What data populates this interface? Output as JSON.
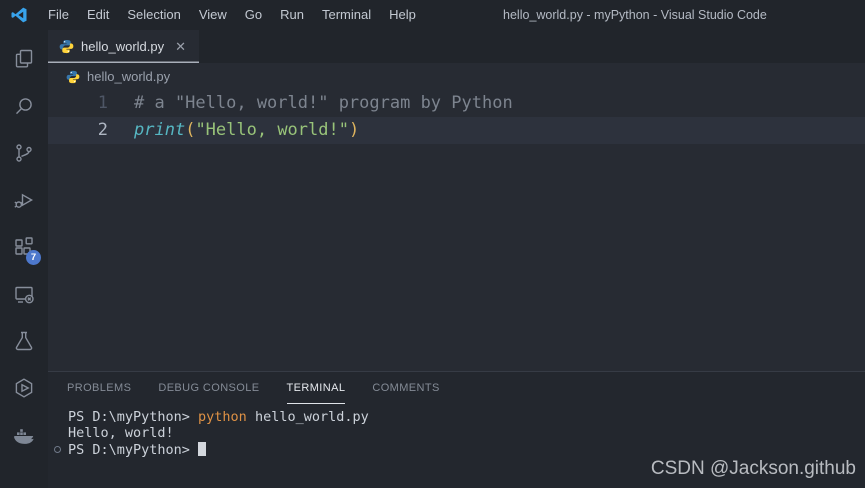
{
  "window": {
    "title": "hello_world.py - myPython - Visual Studio Code"
  },
  "menubar": {
    "items": [
      {
        "label": "File"
      },
      {
        "label": "Edit"
      },
      {
        "label": "Selection"
      },
      {
        "label": "View"
      },
      {
        "label": "Go"
      },
      {
        "label": "Run"
      },
      {
        "label": "Terminal"
      },
      {
        "label": "Help"
      }
    ]
  },
  "activity_bar": {
    "badge": "7",
    "items": [
      {
        "name": "explorer"
      },
      {
        "name": "search"
      },
      {
        "name": "source-control"
      },
      {
        "name": "run-and-debug"
      },
      {
        "name": "extensions"
      },
      {
        "name": "remote-explorer"
      },
      {
        "name": "testing"
      },
      {
        "name": "extension-hexagon-play"
      },
      {
        "name": "docker"
      }
    ]
  },
  "editor": {
    "tab": {
      "label": "hello_world.py",
      "close_icon": "✕"
    },
    "breadcrumb": {
      "file": "hello_world.py"
    },
    "lines": [
      {
        "num": "1",
        "comment": "# a \"Hello, world!\" program by Python"
      },
      {
        "num": "2",
        "func": "print",
        "paren_open": "(",
        "string": "\"Hello, world!\"",
        "paren_close": ")"
      }
    ]
  },
  "panel": {
    "tabs": [
      {
        "label": "PROBLEMS"
      },
      {
        "label": "DEBUG CONSOLE"
      },
      {
        "label": "TERMINAL"
      },
      {
        "label": "COMMENTS"
      }
    ],
    "active_tab": "TERMINAL"
  },
  "terminal": {
    "line1": {
      "prompt": "PS D:\\myPython> ",
      "command": "python",
      "args": " hello_world.py"
    },
    "line2": {
      "output": "Hello, world!"
    },
    "line3": {
      "prompt": "PS D:\\myPython> "
    }
  },
  "watermark": {
    "text": "CSDN @Jackson.github"
  },
  "colors": {
    "badge_blue": "#4d78cc",
    "logo_blue": "#38a3eb",
    "python_blue": "#3776ab",
    "python_yellow": "#ffd43b",
    "terminal_command_orange": "#de9145",
    "string_green": "#98c379",
    "function_cyan": "#56b6c2",
    "bracket_gold": "#deb45e",
    "comment_gray": "#7d848f",
    "editor_background": "#272b33",
    "chrome_background": "#21252b",
    "current_line": "#2d323d"
  }
}
